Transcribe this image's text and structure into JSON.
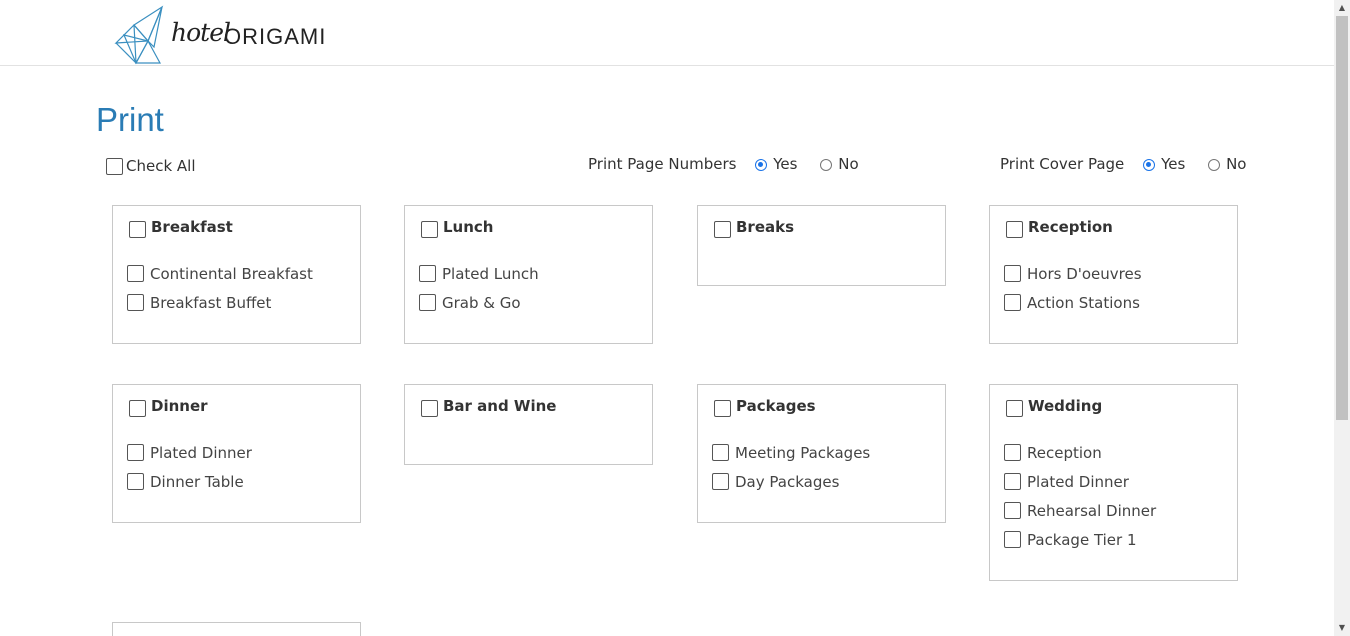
{
  "brand": {
    "script": "hotel",
    "main": "ORIGAMI",
    "accent_color": "#2a7cb5"
  },
  "page_title": "Print",
  "check_all_label": "Check All",
  "print_page_numbers": {
    "label": "Print Page Numbers",
    "yes": "Yes",
    "no": "No",
    "selected": "Yes"
  },
  "print_cover_page": {
    "label": "Print Cover Page",
    "yes": "Yes",
    "no": "No",
    "selected": "Yes"
  },
  "sections": [
    {
      "title": "Breakfast",
      "items": [
        "Continental Breakfast",
        "Breakfast Buffet"
      ]
    },
    {
      "title": "Lunch",
      "items": [
        "Plated Lunch",
        "Grab & Go"
      ]
    },
    {
      "title": "Breaks",
      "items": []
    },
    {
      "title": "Reception",
      "items": [
        "Hors D'oeuvres",
        "Action Stations"
      ]
    },
    {
      "title": "Dinner",
      "items": [
        "Plated Dinner",
        "Dinner Table"
      ]
    },
    {
      "title": "Bar and Wine",
      "items": []
    },
    {
      "title": "Packages",
      "items": [
        "Meeting Packages",
        "Day Packages"
      ]
    },
    {
      "title": "Wedding",
      "items": [
        "Reception",
        "Plated Dinner",
        "Rehearsal Dinner",
        "Package Tier 1"
      ]
    }
  ]
}
